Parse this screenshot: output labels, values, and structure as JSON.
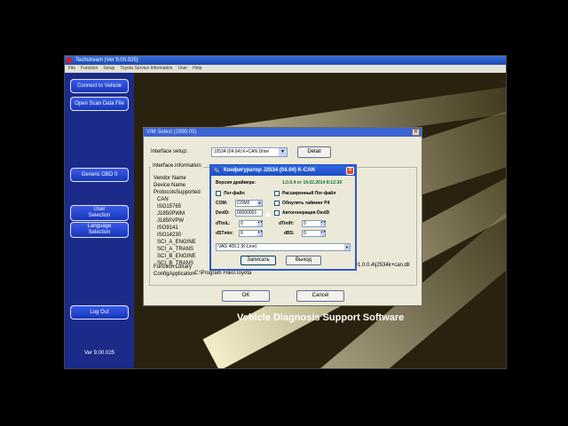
{
  "app": {
    "title": "Techstream (Ver 9.00.025)",
    "menu": [
      "File",
      "Function",
      "Setup",
      "Toyota Service Information",
      "User",
      "Help"
    ]
  },
  "sidebar": {
    "connect": "Connect to Vehicle",
    "open_scan": "Open Scan Data File",
    "generic_obd": "Generic OBD II",
    "user_selection": [
      "User",
      "Selection"
    ],
    "language_selection": [
      "Language",
      "Selection"
    ],
    "log_out": "Log Out",
    "version": "Ver 9.00.025"
  },
  "background": {
    "tagline": "Vehicle Diagnosis Support Software",
    "brand_fragment": "am"
  },
  "vim_dialog": {
    "title": "VIM Select (2999.05)",
    "interface_label": "Interface setup:",
    "interface_value": "J2534 (04.04) K+CAN Drive",
    "detail_button": "Detail",
    "info_legend": "Interface information",
    "info_lines": [
      "Vendor Name",
      "Device Name",
      "ProtocolsSupported",
      "CAN",
      "ISO15765",
      "J1850PWM",
      "J1850VPW",
      "ISO9141",
      "ISO14230",
      "SCI_A_ENGINE",
      "SCI_A_TRANS",
      "SCI_B_ENGINE",
      "SCI_B_TRANS",
      "Function Library",
      "ConfigApplication"
    ],
    "function_library_value": "v1.0.0.4\\j2534k+can.dll",
    "config_application_value": "C:\\Program Files\\Toyota",
    "ok_button": "OK",
    "cancel_button": "Cancel"
  },
  "cfg_dialog": {
    "title": "Конфигуратор J2534 (04.04) K-CAN",
    "driver_label": "Версия драйвера:",
    "driver_value": "1.0.0.4 от 14.02.2014 8:12:30",
    "log_file": "Лог-файл",
    "ext_log": "Расширенный Лог-файл",
    "com_label": "COM:",
    "com_value": "COM2",
    "reset_p4": "Обнулять тайминг P4",
    "devid_label": "DevID:",
    "devid_value": "00000001",
    "autogen_devid": "Автогенерация DevID",
    "tinil_label": "dTiniL:",
    "tinil_value": "0",
    "tinih_label": "dTiniH:",
    "tinih_value": "0",
    "stmin_label": "dSTmin:",
    "stmin_value": "0",
    "bs_label": "dBS:",
    "bs_value": "0",
    "device_value": "VAG 409.1 (K-Line)",
    "save_button": "Записать",
    "exit_button": "Выход"
  }
}
